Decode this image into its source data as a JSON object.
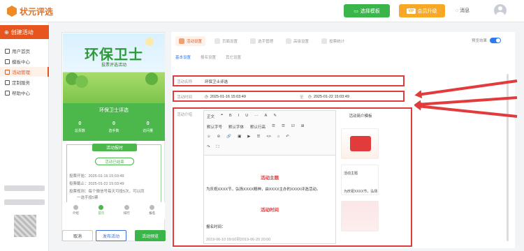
{
  "app": {
    "brand": "状元评选"
  },
  "header": {
    "choose_template": "选择模板",
    "vip_badge": "VIP",
    "vip_upgrade": "会员升级",
    "messages": "消息"
  },
  "sidebar": {
    "create": "创建活动",
    "items": [
      {
        "label": "用户首页"
      },
      {
        "label": "模板中心"
      },
      {
        "label": "活动管理"
      },
      {
        "label": "定制服务"
      },
      {
        "label": "帮助中心"
      }
    ]
  },
  "phone": {
    "poster_title": "环保卫士",
    "poster_sub": "投票评选活动",
    "band_title": "环保卫士评选",
    "stats": [
      {
        "value": "0",
        "label": "总票数"
      },
      {
        "value": "0",
        "label": "选手数"
      },
      {
        "value": "0",
        "label": "访问量"
      }
    ],
    "time_head": "活动报时",
    "ended": "活动已结束",
    "times": [
      "投票开始：2025-01-16 15:03:49",
      "投票截止：2025-01-22 15:03:49",
      "投票规则：每个微信号每天可投5次，可以同",
      "一选手投5票"
    ],
    "nav": [
      "介绍",
      "首页",
      "排行",
      "报名"
    ],
    "buttons": {
      "cancel": "取消",
      "publish": "发布活动",
      "preview": "活动预览"
    }
  },
  "main": {
    "tabs": [
      "活动设置",
      "页面设置",
      "选手管理",
      "高级设置",
      "投票统计"
    ],
    "preview_label": "预览效果",
    "sub_tabs": [
      "基本设置",
      "报名设置",
      "其它设置"
    ],
    "name_label": "活动名称",
    "name_value": "环保卫士评选",
    "time_label": "活动时间",
    "start": "2025-01-16 15:03:49",
    "to": "至",
    "end": "2025-01-22 15:03:49",
    "intro_label": "活动介绍",
    "toolbar": {
      "row1": [
        "正文",
        "❝",
        "B",
        "I",
        "U",
        "···",
        "A",
        "✎"
      ],
      "row2": [
        "默认字号",
        "默认字体",
        "默认行高",
        "☰",
        "☰",
        "☑",
        "⊞"
      ],
      "row3": [
        "☺",
        "⊘",
        "🔗",
        "▣",
        "▶",
        "☰",
        "<>",
        "⌂",
        "↶"
      ],
      "row4": [
        "↷",
        "⛶"
      ]
    },
    "content": {
      "h1": "活动主题",
      "p1": "为庆祝XXXX节，弘扬XXXX精神，由XXXX主办的XXXX评选活动。",
      "h2": "活动时间",
      "p2": "报名时间：",
      "p3": "2019-06-10 09:00到2019-06-20 20:00"
    },
    "template_panel": {
      "title": "活动简介模板",
      "card2_label": "活动主题",
      "card2_text": "为庆祝XXXX节，弘扬"
    }
  },
  "colors": {
    "accent": "#e8541e",
    "green": "#39b54a",
    "annotation": "#e23b3b",
    "blue": "#2d7bf0"
  }
}
